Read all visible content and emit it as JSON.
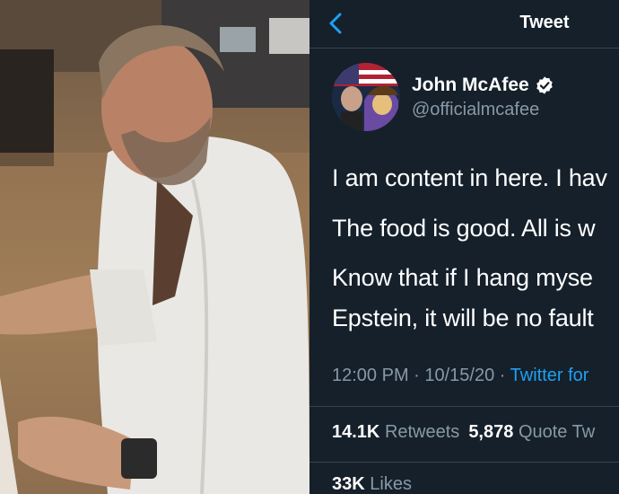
{
  "header": {
    "title": "Tweet",
    "back_icon": "chevron-left-icon"
  },
  "tweet": {
    "author_name": "John McAfee",
    "author_handle": "@officialmcafee",
    "verified": true,
    "lines": [
      "I am content in here. I hav",
      "The food is good. All is w",
      "Know that if I hang myse",
      "Epstein, it will be no fault"
    ],
    "timestamp": "12:00 PM · 10/15/20 ·",
    "source": "Twitter for",
    "retweets_count": "14.1K",
    "retweets_label": "Retweets",
    "quote_count": "5,878",
    "quote_label": "Quote Tw",
    "likes_count": "33K",
    "likes_label": "Likes"
  },
  "colors": {
    "background": "#15202b",
    "accent": "#1da1f2",
    "secondary_text": "#8899a6",
    "divider": "#38444d"
  }
}
